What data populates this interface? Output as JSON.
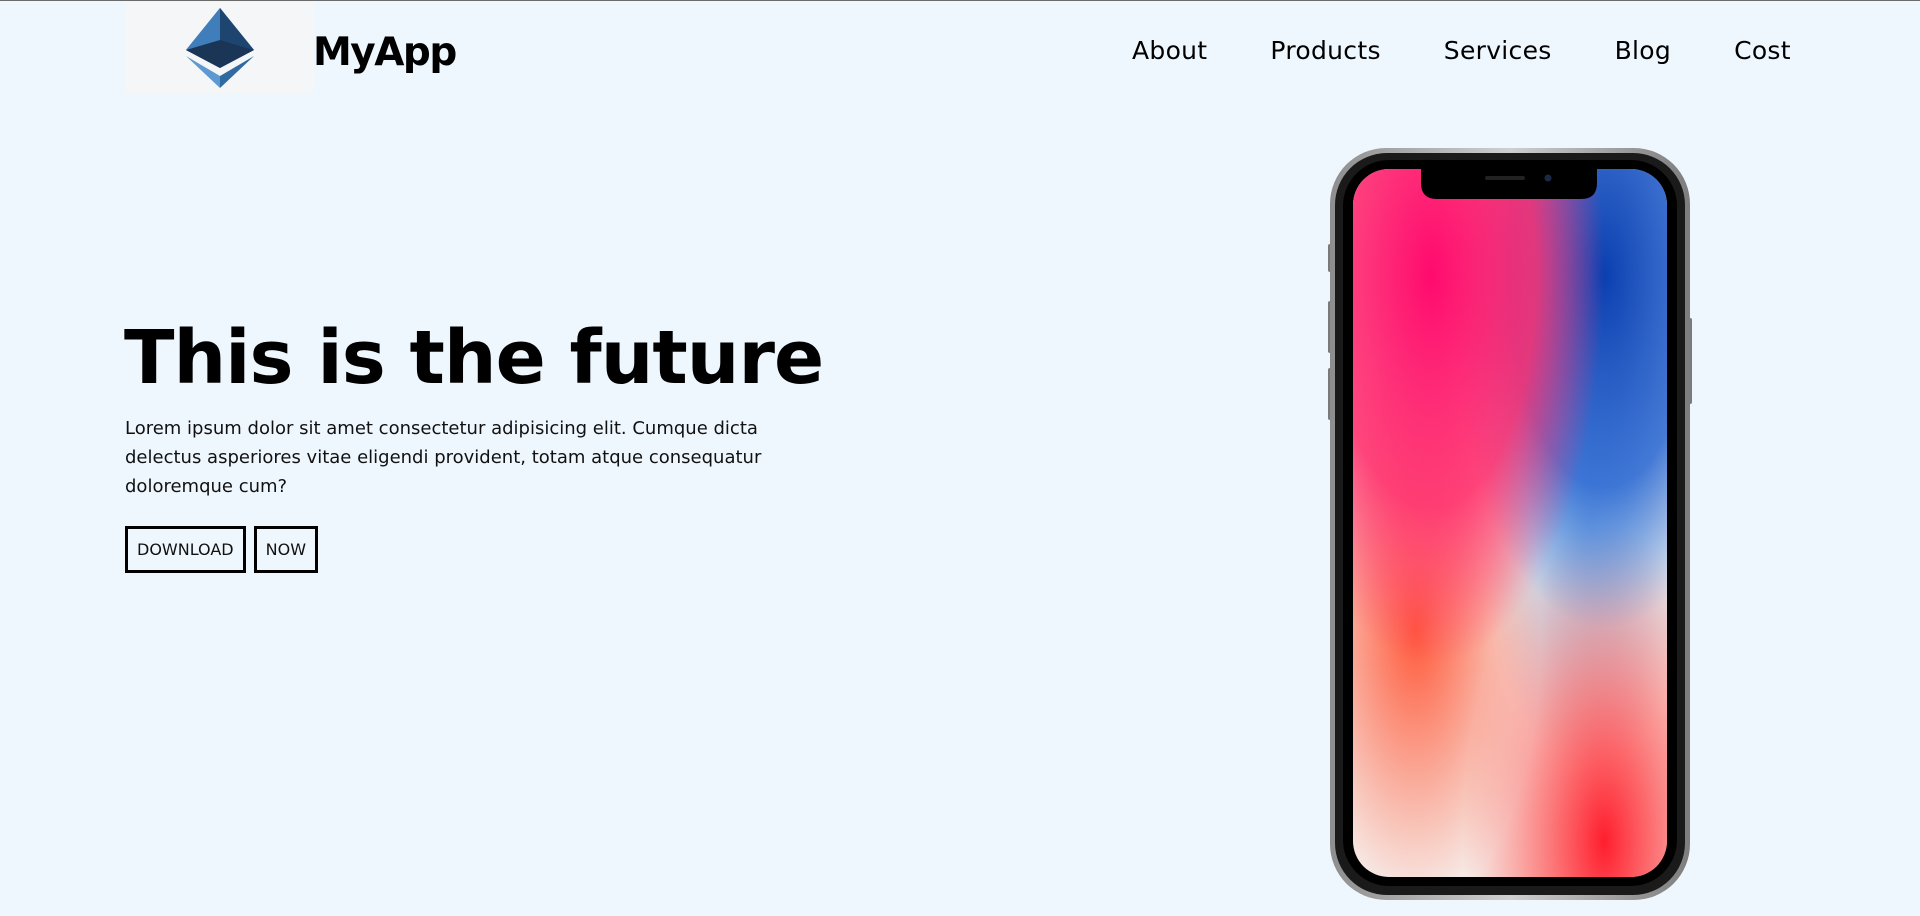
{
  "header": {
    "logo_icon": "ethereum-diamond-icon",
    "brand": "MyApp",
    "nav": [
      "About",
      "Products",
      "Services",
      "Blog",
      "Cost"
    ]
  },
  "hero": {
    "title": "This is the future",
    "description": "Lorem ipsum dolor sit amet consectetur adipisicing elit. Cumque dicta delectus asperiores vitae eligendi provident, totam atque consequatur doloremque cum?",
    "buttons": [
      "DOWNLOAD",
      "NOW"
    ]
  },
  "phone": {
    "icon": "smartphone-image"
  },
  "colors": {
    "background": "#eff7fe",
    "logo_bg": "#f5f6f7",
    "logo_dark": "#1b3556",
    "logo_light": "#4a86c0"
  }
}
